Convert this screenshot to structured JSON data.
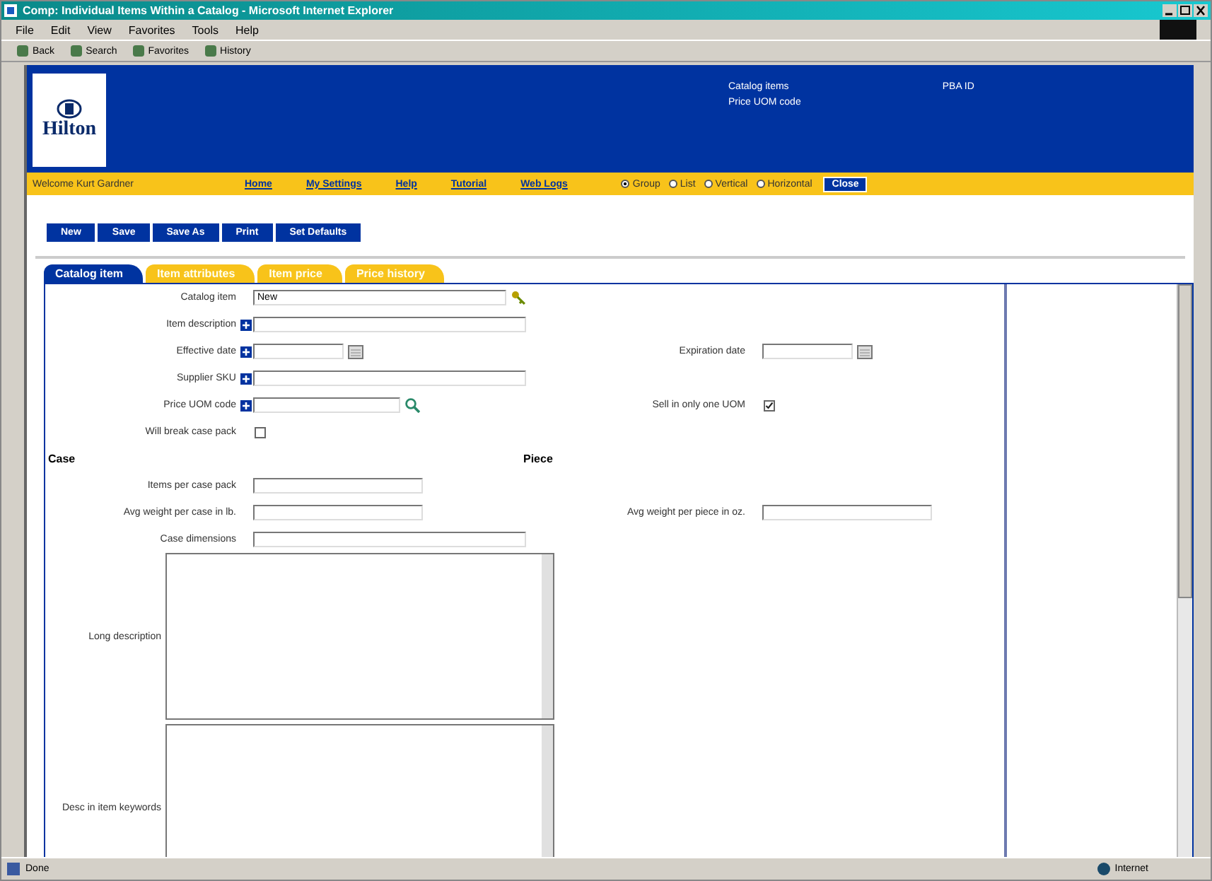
{
  "window": {
    "title": "Comp: Individual Items Within a Catalog - Microsoft Internet Explorer"
  },
  "menu": [
    "File",
    "Edit",
    "View",
    "Favorites",
    "Tools",
    "Help"
  ],
  "toolbar": [
    "Back",
    "Search",
    "Favorites",
    "History"
  ],
  "header": {
    "logo": "Hilton",
    "info": [
      "Catalog items",
      "Price UOM code"
    ],
    "user": "PBA ID"
  },
  "nav": {
    "welcome": "Welcome Kurt Gardner",
    "links": [
      "Home",
      "My Settings",
      "Help",
      "Tutorial",
      "Web Logs"
    ],
    "views": [
      {
        "label": "Group",
        "selected": true
      },
      {
        "label": "List",
        "selected": false
      },
      {
        "label": "Vertical",
        "selected": false
      },
      {
        "label": "Horizontal",
        "selected": false
      }
    ],
    "close": "Close"
  },
  "actions": [
    "New",
    "Save",
    "Save As",
    "Print",
    "Set Defaults"
  ],
  "tabs": [
    {
      "label": "Catalog item",
      "selected": true
    },
    {
      "label": "Item attributes",
      "selected": false
    },
    {
      "label": "Item price",
      "selected": false
    },
    {
      "label": "Price history",
      "selected": false
    }
  ],
  "form": [
    {
      "left": {
        "kind": "key",
        "label": "Catalog item",
        "value": "New"
      }
    },
    {
      "left": {
        "kind": "long",
        "label": "Item description",
        "expand": true
      }
    },
    {
      "left": {
        "kind": "date",
        "label": "Effective date",
        "expand": true
      },
      "right": {
        "kind": "date",
        "label": "Expiration date"
      }
    },
    {
      "left": {
        "kind": "long",
        "label": "Supplier SKU",
        "expand": true
      }
    },
    {
      "left": {
        "kind": "lookup",
        "label": "Price UOM code",
        "expand": true
      },
      "right": {
        "kind": "checkbox",
        "label": "Sell in only one UOM",
        "checked": true
      }
    },
    {
      "left": {
        "kind": "checkbox",
        "label": "Will break case pack",
        "checked": false
      }
    },
    {
      "left": {
        "kind": "section",
        "label": "Case"
      },
      "right": {
        "kind": "section",
        "label": "Piece"
      }
    },
    {
      "left": {
        "kind": "text",
        "label": "Items per case pack"
      }
    },
    {
      "left": {
        "kind": "text",
        "label": "Avg weight per case in lb."
      },
      "right": {
        "kind": "text",
        "label": "Avg weight per piece in oz."
      }
    },
    {
      "left": {
        "kind": "long",
        "label": "Case dimensions"
      }
    },
    {
      "left": {
        "kind": "textarea",
        "label": "Long description"
      }
    },
    {
      "left": {
        "kind": "textarea",
        "label": "Desc in item keywords"
      }
    }
  ],
  "status": {
    "text": "Done",
    "zone": "Internet"
  }
}
